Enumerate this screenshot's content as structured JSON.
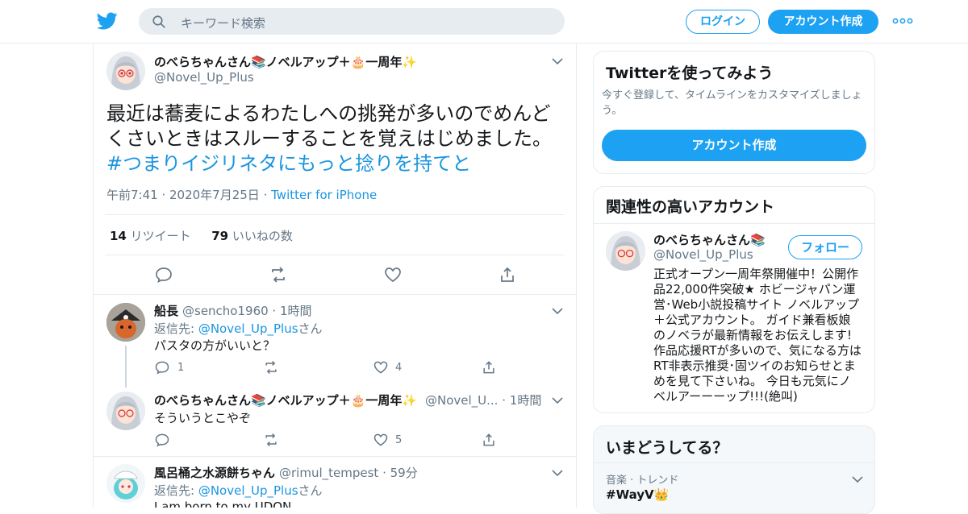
{
  "header": {
    "search_placeholder": "キーワード検索",
    "login_label": "ログイン",
    "signup_label": "アカウント作成"
  },
  "main_tweet": {
    "name": "のべらちゃんさん📚ノベルアップ＋🎂一周年✨",
    "handle": "@Novel_Up_Plus",
    "text_line1": "最近は蕎麦によるわたしへの挑発が多いのでめんど",
    "text_line2": "くさいときはスルーすることを覚えはじめました。",
    "hashtag": "#つまりイジリネタにもっと捻りを持てと",
    "time": "午前7:41",
    "date": "2020年7月25日",
    "source": "Twitter for iPhone",
    "retweets": "14",
    "retweets_label": "リツイート",
    "likes": "79",
    "likes_label": "いいねの数"
  },
  "replies": [
    {
      "name": "船長",
      "handle": "@sencho1960",
      "time": "1時間",
      "reply_to_prefix": "返信先: ",
      "reply_to": "@Novel_Up_Plus",
      "reply_to_suffix": "さん",
      "text": "パスタの方がいいと？",
      "reply_count": "1",
      "like_count": "4"
    },
    {
      "name": "のべらちゃんさん📚ノベルアップ＋🎂一周年✨",
      "handle": "@Novel_U...",
      "time": "1時間",
      "text": "そういうとこやぞ",
      "like_count": "5"
    },
    {
      "name": "風呂桶之水源餅ちゃん",
      "handle": "@rimul_tempest",
      "time": "59分",
      "reply_to_prefix": "返信先: ",
      "reply_to": "@Novel_Up_Plus",
      "reply_to_suffix": "さん",
      "text": "I  am born to  my UDON"
    }
  ],
  "sidebar": {
    "try_title": "Twitterを使ってみよう",
    "try_desc_line1": "今すぐ登録して、タイムラインをカスタマイズしましょ",
    "try_desc_line2": "う。",
    "try_button": "アカウント作成",
    "related_title": "関連性の高いアカウント",
    "related_name": "のべらちゃんさん📚",
    "related_handle": "@Novel_Up_Plus",
    "follow_label": "フォロー",
    "bio_lines": [
      "正式オープン一周年祭開催中！公開作",
      "品22,000件突破★ ホビージャパン運",
      "営･Web小説投稿サイト ノベルアップ",
      "＋公式アカウント。 ガイド兼看板娘",
      "のノベラが最新情報をお伝えします!",
      "作品応援RTが多いので、気になる方は",
      "RT非表示推奨･固ツイのお知らせとま",
      "めを見て下さいね。 今日も元気にノ",
      "ベルアーーーップ!!!(絶叫)"
    ],
    "trends_title": "いまどうしてる？",
    "trend_category": "音楽 · トレンド",
    "trend_name": "#WayV👑"
  },
  "colors": {
    "brand_blue": "#1da1f2",
    "link_blue": "#1b95e0",
    "muted": "#657786",
    "border": "#e6ecf0"
  }
}
